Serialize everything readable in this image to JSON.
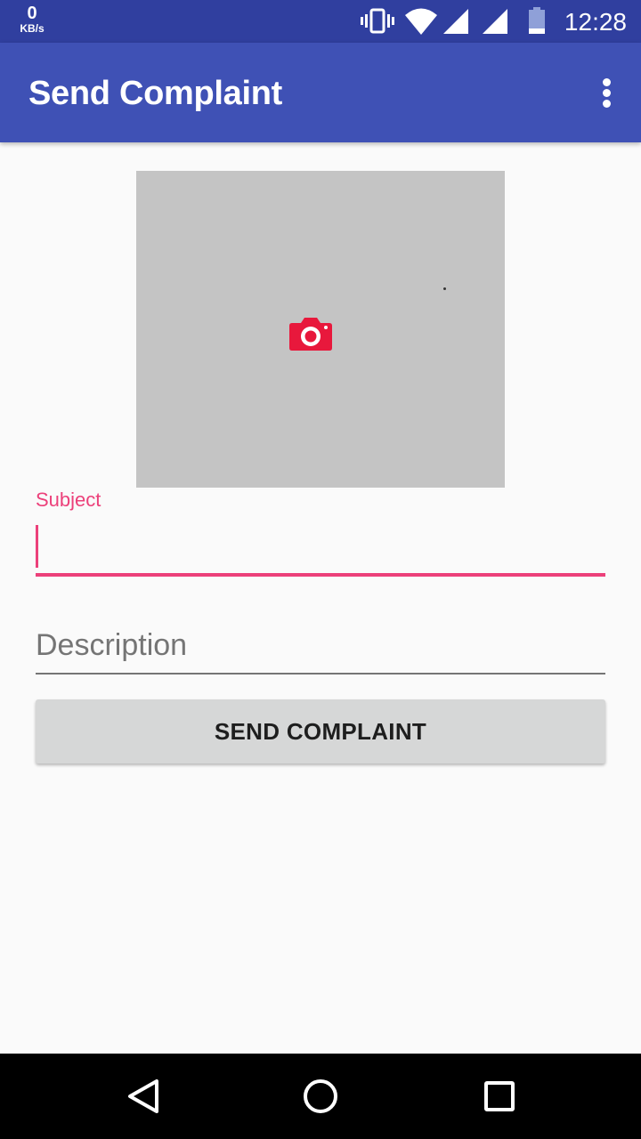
{
  "status_bar": {
    "net_speed_value": "0",
    "net_speed_unit": "KB/s",
    "time": "12:28",
    "icons": [
      "vibrate-icon",
      "wifi-icon",
      "signal-icon",
      "signal-icon",
      "battery-icon"
    ]
  },
  "app_bar": {
    "title": "Send Complaint",
    "menu_icon": "overflow-menu-icon"
  },
  "photo": {
    "icon": "camera-icon",
    "icon_color": "#e8183c"
  },
  "form": {
    "subject_label": "Subject",
    "subject_value": "",
    "description_placeholder": "Description",
    "description_value": "",
    "send_label": "SEND COMPLAINT"
  },
  "nav_bar": {
    "icons": [
      "back-icon",
      "home-icon",
      "recents-icon"
    ]
  },
  "colors": {
    "status_bar": "#303f9f",
    "app_bar": "#3f51b5",
    "accent": "#ec407a",
    "button": "#d6d7d7"
  }
}
